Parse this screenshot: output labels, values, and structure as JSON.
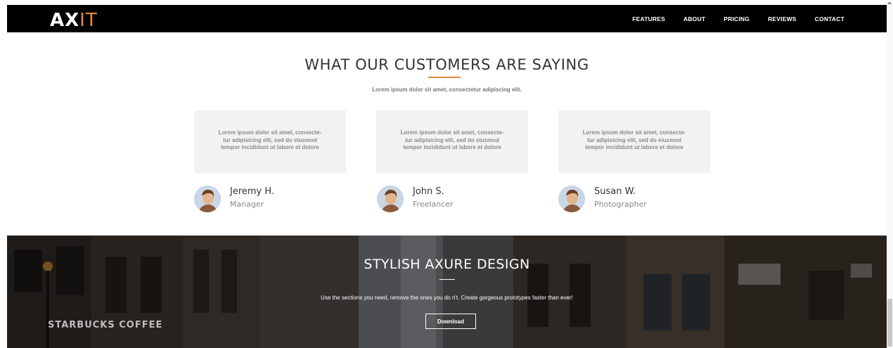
{
  "nav": {
    "logo_primary": "AX",
    "logo_accent": "IT",
    "items": [
      "FEATURES",
      "ABOUT",
      "PRICING",
      "REVIEWS",
      "CONTACT"
    ]
  },
  "testimonials": {
    "title": "WHAT OUR CUSTOMERS ARE SAYING",
    "subtitle": "Lorem ipsum dolor sit amet, consectetur adipiscing elit.",
    "items": [
      {
        "quote_l1": "Lorem ipsum dolor sit amet, consecte-",
        "quote_l2": "tur adipisicing elit, sed do eiusmod",
        "quote_l3": "tempor incididunt ut labore et dolore",
        "name": "Jeremy H.",
        "role": "Manager"
      },
      {
        "quote_l1": "Lorem ipsum dolor sit amet, consecte-",
        "quote_l2": "tur adipisicing elit, sed do eiusmod",
        "quote_l3": "tempor incididunt ut labore et dolore",
        "name": "John S.",
        "role": "Freelancer"
      },
      {
        "quote_l1": "Lorem ipsum dolor sit amet, consecte-",
        "quote_l2": "tur adipisicing elit, sed do eiusmod",
        "quote_l3": "tempor incididunt ut labore et dolore",
        "name": "Susan W.",
        "role": "Photographer"
      }
    ]
  },
  "hero": {
    "title": "STYLISH AXURE DESIGN",
    "subtitle": "Use the sections you need, remove the ones you do n't. Create gorgeous prototypes faster than ever!",
    "button": "Download",
    "sign_text": "STARBUCKS COFFEE"
  },
  "colors": {
    "accent": "#e38a3c",
    "nav_bg": "#000000",
    "card_bg": "#f2f2f2"
  }
}
